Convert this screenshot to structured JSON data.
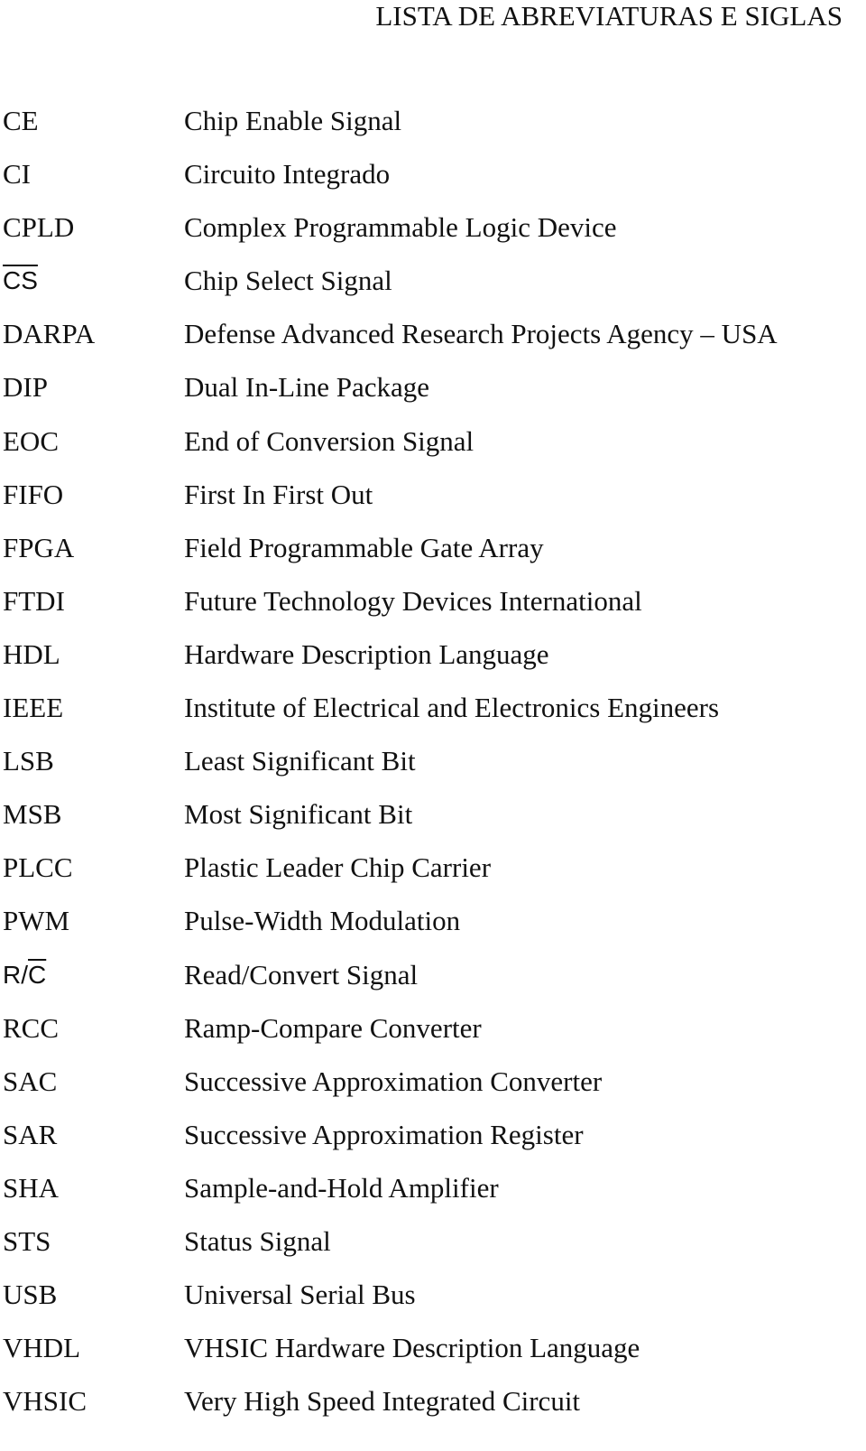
{
  "document": {
    "title": "LISTA DE ABREVIATURAS E SIGLAS",
    "entries": [
      {
        "abbr": "CE",
        "definition": "Chip Enable Signal"
      },
      {
        "abbr": "CI",
        "definition": "Circuito Integrado"
      },
      {
        "abbr": "CPLD",
        "definition": "Complex Programmable Logic Device"
      },
      {
        "abbr": "CS",
        "overline": "CS",
        "definition": "Chip Select Signal"
      },
      {
        "abbr": "DARPA",
        "definition": "Defense Advanced Research Projects Agency – USA"
      },
      {
        "abbr": "DIP",
        "definition": "Dual In-Line Package"
      },
      {
        "abbr": "EOC",
        "definition": "End of Conversion Signal"
      },
      {
        "abbr": "FIFO",
        "definition": "First In First Out"
      },
      {
        "abbr": "FPGA",
        "definition": "Field Programmable Gate Array"
      },
      {
        "abbr": "FTDI",
        "definition": "Future Technology Devices International"
      },
      {
        "abbr": "HDL",
        "definition": "Hardware Description Language"
      },
      {
        "abbr": "IEEE",
        "definition": "Institute of Electrical and Electronics Engineers"
      },
      {
        "abbr": "LSB",
        "definition": "Least Significant Bit"
      },
      {
        "abbr": "MSB",
        "definition": "Most Significant Bit"
      },
      {
        "abbr": "PLCC",
        "definition": "Plastic Leader Chip Carrier"
      },
      {
        "abbr": "PWM",
        "definition": "Pulse-Width Modulation"
      },
      {
        "abbr": "R/C",
        "prefix": "R/",
        "overline": "C",
        "definition": "Read/Convert Signal"
      },
      {
        "abbr": "RCC",
        "definition": "Ramp-Compare Converter"
      },
      {
        "abbr": "SAC",
        "definition": "Successive Approximation Converter"
      },
      {
        "abbr": "SAR",
        "definition": "Successive Approximation Register"
      },
      {
        "abbr": "SHA",
        "definition": "Sample-and-Hold Amplifier"
      },
      {
        "abbr": "STS",
        "definition": "Status Signal"
      },
      {
        "abbr": "USB",
        "definition": "Universal Serial Bus"
      },
      {
        "abbr": "VHDL",
        "definition": "VHSIC Hardware Description Language"
      },
      {
        "abbr": "VHSIC",
        "definition": "Very High Speed Integrated Circuit"
      }
    ]
  }
}
